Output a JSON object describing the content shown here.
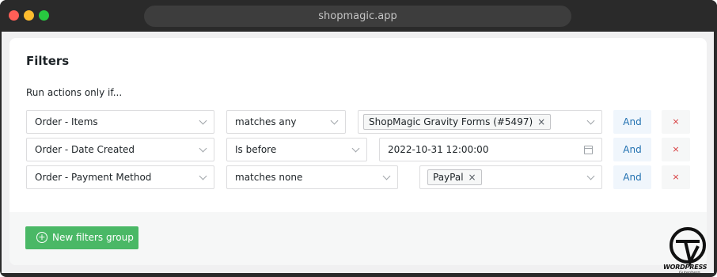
{
  "browser": {
    "url": "shopmagic.app"
  },
  "filters": {
    "title": "Filters",
    "subtitle": "Run actions only if...",
    "rows": [
      {
        "field": "Order - Items",
        "operator": "matches any",
        "value_tag": "ShopMagic Gravity Forms (#5497)",
        "and": "And",
        "remove": "×"
      },
      {
        "field": "Order - Date Created",
        "operator": "Is before",
        "value": "2022-10-31 12:00:00",
        "and": "And",
        "remove": "×"
      },
      {
        "field": "Order - Payment Method",
        "operator": "matches none",
        "value_tag": "PayPal",
        "and": "And",
        "remove": "×"
      }
    ],
    "new_group_label": "New filters group"
  },
  "watermark": {
    "text": "WORDPRESS",
    "sub": "Gutenberg"
  },
  "icons": {
    "remove_tag": "×",
    "add": "+",
    "date": "calendar-icon"
  },
  "colors": {
    "accent_blue": "#2271b1",
    "danger": "#d63638",
    "success": "#4ab866"
  }
}
